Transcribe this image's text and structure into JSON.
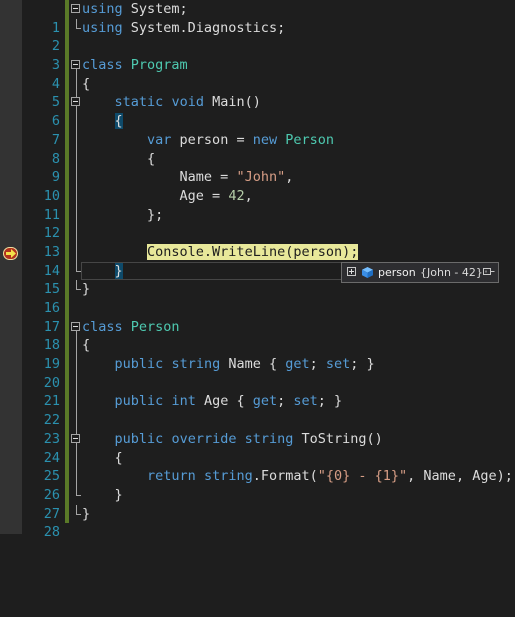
{
  "editor": {
    "lines": [
      {
        "n": "1"
      },
      {
        "n": "2"
      },
      {
        "n": "3"
      },
      {
        "n": "4"
      },
      {
        "n": "5"
      },
      {
        "n": "6"
      },
      {
        "n": "7"
      },
      {
        "n": "8"
      },
      {
        "n": "9"
      },
      {
        "n": "10"
      },
      {
        "n": "11"
      },
      {
        "n": "12"
      },
      {
        "n": "13"
      },
      {
        "n": "14"
      },
      {
        "n": "15"
      },
      {
        "n": "16"
      },
      {
        "n": "17"
      },
      {
        "n": "18"
      },
      {
        "n": "19"
      },
      {
        "n": "20"
      },
      {
        "n": "21"
      },
      {
        "n": "22"
      },
      {
        "n": "23"
      },
      {
        "n": "24"
      },
      {
        "n": "25"
      },
      {
        "n": "26"
      },
      {
        "n": "27"
      },
      {
        "n": "28"
      }
    ],
    "code": {
      "l1": {
        "kw": "using",
        "rest": " System;"
      },
      "l2": {
        "kw": "using",
        "rest": " System.Diagnostics;"
      },
      "l4": {
        "kw": "class",
        "ty": "Program"
      },
      "l5": "{",
      "l6": {
        "kw1": "static",
        "kw2": "void",
        "rest": " Main()"
      },
      "l7": "{",
      "l8": {
        "kw": "var",
        "mid": " person = ",
        "kw2": "new",
        "ty": "Person"
      },
      "l9": "{",
      "l10": {
        "pre": "Name = ",
        "str": "\"John\"",
        "post": ","
      },
      "l11": {
        "pre": "Age = ",
        "num": "42",
        "post": ","
      },
      "l12": "};",
      "l14": "Console.WriteLine(person);",
      "l15": "}",
      "l16": "}",
      "l18": {
        "kw": "class",
        "ty": "Person"
      },
      "l19": "{",
      "l20": {
        "kw1": "public",
        "kw2": "string",
        "mid": " Name { ",
        "get": "get",
        "sep": "; ",
        "set": "set",
        "end": "; }"
      },
      "l22": {
        "kw1": "public",
        "kw2": "int",
        "mid": " Age { ",
        "get": "get",
        "sep": "; ",
        "set": "set",
        "end": "; }"
      },
      "l24": {
        "kw1": "public",
        "kw2": "override",
        "kw3": "string",
        "rest": " ToString()"
      },
      "l25": "{",
      "l26": {
        "kw": "return",
        "kw2": "string",
        "mid": ".Format(",
        "str": "\"{0} - {1}\"",
        "end": ", Name, Age);"
      },
      "l27": "}",
      "l28": "}"
    }
  },
  "datatip": {
    "name": "person",
    "value": "{John - 42}",
    "icon": "object-cube-icon"
  },
  "colors": {
    "keyword": "#569cd6",
    "type": "#4ec9b0",
    "string": "#d69d85",
    "number": "#b5cea8",
    "line_number": "#2b91af",
    "current_statement_highlight": "#e8e89a"
  }
}
